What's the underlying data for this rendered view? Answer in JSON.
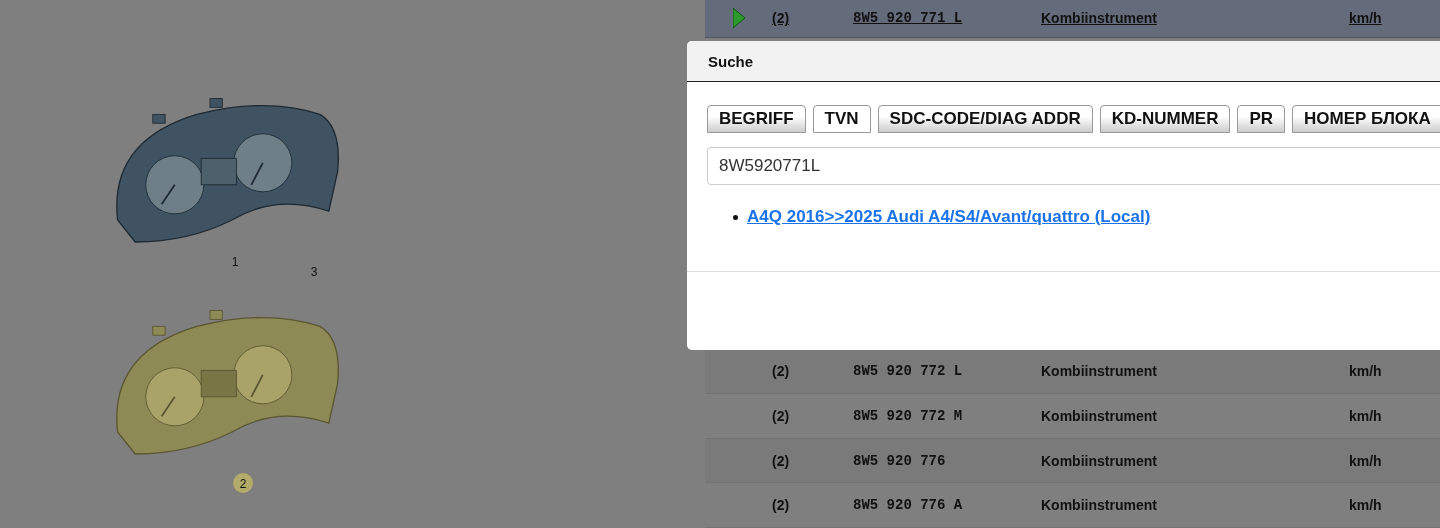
{
  "illustration": {
    "parts": [
      {
        "kind": "cluster",
        "selected": false,
        "callouts": [
          {
            "label": "1",
            "selected": false
          },
          {
            "label": "3",
            "selected": false
          }
        ]
      },
      {
        "kind": "cluster",
        "selected": true,
        "callouts": [
          {
            "label": "2",
            "selected": true
          }
        ]
      }
    ]
  },
  "table": {
    "rows": [
      {
        "qty": "(2)",
        "part": "8W5 920 771 L",
        "name": "Kombiinstrument",
        "unit": "km/h",
        "selected": true
      },
      {
        "qty": "(2)",
        "part": "8W5 920 772 L",
        "name": "Kombiinstrument",
        "unit": "km/h",
        "selected": false
      },
      {
        "qty": "(2)",
        "part": "8W5 920 772 M",
        "name": "Kombiinstrument",
        "unit": "km/h",
        "selected": false
      },
      {
        "qty": "(2)",
        "part": "8W5 920 776",
        "name": "Kombiinstrument",
        "unit": "km/h",
        "selected": false
      },
      {
        "qty": "(2)",
        "part": "8W5 920 776 A",
        "name": "Kombiinstrument",
        "unit": "km/h",
        "selected": false
      }
    ]
  },
  "dialog": {
    "title": "Suche",
    "tabs": [
      {
        "label": "BEGRIFF",
        "selected": false
      },
      {
        "label": "TVN",
        "selected": true
      },
      {
        "label": "SDC-CODE/DIAG ADDR",
        "selected": false
      },
      {
        "label": "KD-NUMMER",
        "selected": false
      },
      {
        "label": "PR",
        "selected": false
      },
      {
        "label": "НОМЕР БЛОКА",
        "selected": false
      }
    ],
    "search": {
      "value": "8W5920771L"
    },
    "results": [
      "A4Q 2016>>2025 Audi A4/S4/Avant/quattro (Local)"
    ]
  }
}
